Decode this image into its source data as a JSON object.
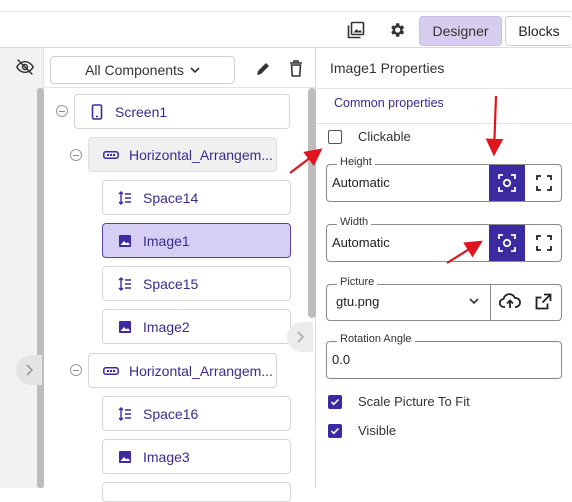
{
  "header": {
    "tabs": [
      {
        "label": "Designer",
        "active": true
      },
      {
        "label": "Blocks",
        "active": false
      }
    ],
    "icons": [
      "gallery-icon",
      "gear-icon"
    ]
  },
  "components_panel": {
    "filter_label": "All Components",
    "icons": [
      "eye-off-icon",
      "pencil-icon",
      "trash-icon"
    ],
    "tree": [
      {
        "label": "Screen1",
        "icon": "phone-icon",
        "level": 0
      },
      {
        "label": "Horizontal_Arrangem...",
        "icon": "horizontal-arrangement-icon",
        "level": 1
      },
      {
        "label": "Space14",
        "icon": "space-icon",
        "level": 2
      },
      {
        "label": "Image1",
        "icon": "image-icon",
        "level": 2,
        "selected": true
      },
      {
        "label": "Space15",
        "icon": "space-icon",
        "level": 2
      },
      {
        "label": "Image2",
        "icon": "image-icon",
        "level": 2
      },
      {
        "label": "Horizontal_Arrangem...",
        "icon": "horizontal-arrangement-icon",
        "level": 1
      },
      {
        "label": "Space16",
        "icon": "space-icon",
        "level": 2
      },
      {
        "label": "Image3",
        "icon": "image-icon",
        "level": 2
      }
    ]
  },
  "properties": {
    "title": "Image1 Properties",
    "section": "Common properties",
    "clickable": {
      "label": "Clickable",
      "checked": false
    },
    "height": {
      "label": "Height",
      "value": "Automatic"
    },
    "width": {
      "label": "Width",
      "value": "Automatic"
    },
    "picture": {
      "label": "Picture",
      "value": "gtu.png"
    },
    "rotation": {
      "label": "Rotation Angle",
      "value": "0.0"
    },
    "scale_to_fit": {
      "label": "Scale Picture To Fit",
      "checked": true
    },
    "visible": {
      "label": "Visible",
      "checked": true
    }
  },
  "colors": {
    "accent": "#3b2aa0",
    "selected_bg": "#d7cff3",
    "annotation_arrow": "#e0141e"
  }
}
